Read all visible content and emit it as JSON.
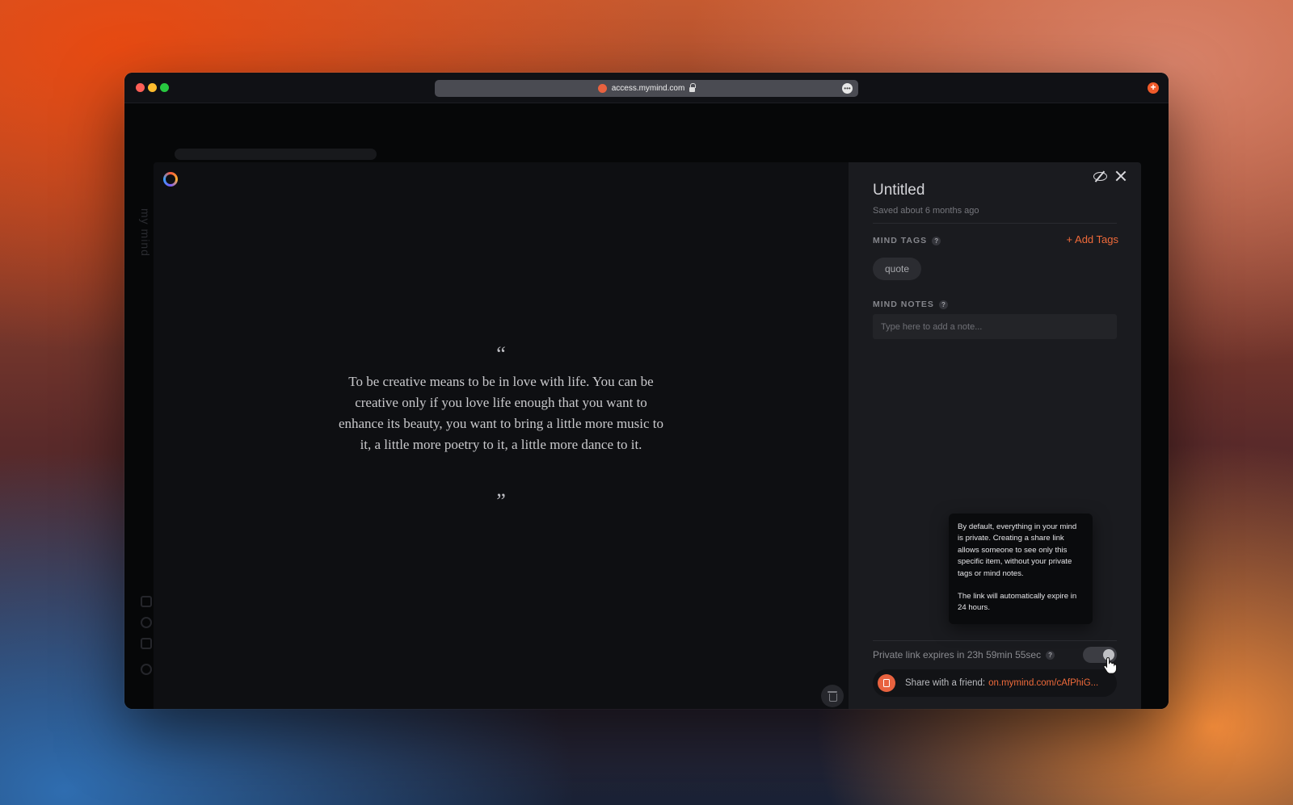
{
  "browser": {
    "url": "access.mymind.com"
  },
  "background_app": {
    "sidebar_brand": "my mind"
  },
  "preview": {
    "quote_open": "“",
    "quote_text": "To be creative means to be in love with life. You can be creative only if you love life enough that you want to enhance its beauty, you want to bring a little more music to it, a little more poetry to it, a little more dance to it.",
    "quote_close": "”"
  },
  "panel": {
    "title": "Untitled",
    "saved": "Saved about 6 months ago",
    "mind_tags_label": "MIND TAGS",
    "add_tags": "+ Add Tags",
    "tags": [
      "quote"
    ],
    "mind_notes_label": "MIND NOTES",
    "note_placeholder": "Type here to add a note...",
    "help_glyph": "?",
    "tooltip_p1": "By default, everything in your mind is private. Creating a share link allows someone to see only this specific item, without your private tags or mind notes.",
    "tooltip_p2": "The link will automatically expire in 24 hours.",
    "expiry_text": "Private link expires in 23h 59min 55sec",
    "share_label": "Share with a friend:",
    "share_link": "on.mymind.com/cAfPhiG..."
  },
  "colors": {
    "accent": "#ef6a3a",
    "panel_bg": "#1a1b1f",
    "preview_bg": "#0e0f12"
  },
  "toggle": {
    "on": true
  }
}
